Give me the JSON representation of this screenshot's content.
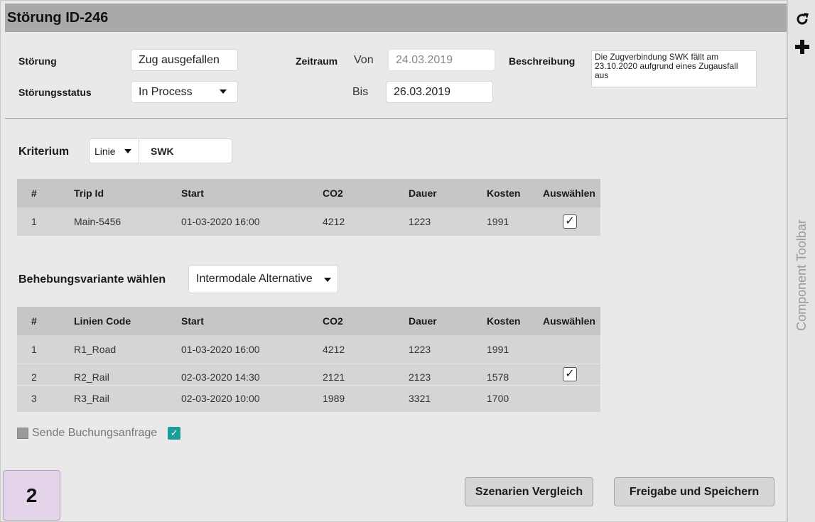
{
  "title": "Störung ID-246",
  "form": {
    "stoerung_label": "Störung",
    "stoerung_value": "Zug ausgefallen",
    "status_label": "Störungsstatus",
    "status_value": "In Process",
    "zeitraum_label": "Zeitraum",
    "von_label": "Von",
    "von_value": "24.03.2019",
    "bis_label": "Bis",
    "bis_value": "26.03.2019",
    "beschreibung_label": "Beschreibung",
    "beschreibung_value": "Die Zugverbindung SWK fällt am 23.10.2020 aufgrund eines Zugausfall aus"
  },
  "kriterium": {
    "label": "Kriterium",
    "type_value": "Linie",
    "filter_value": "SWK"
  },
  "trip_table": {
    "headers": [
      "#",
      "Trip Id",
      "Start",
      "CO2",
      "Dauer",
      "Kosten",
      "Auswählen"
    ],
    "rows": [
      {
        "num": "1",
        "id": "Main-5456",
        "start": "01-03-2020 16:00",
        "co2": "4212",
        "dauer": "1223",
        "kosten": "1991",
        "selected": true
      }
    ]
  },
  "behebung": {
    "label": "Behebungsvariante wählen",
    "value": "Intermodale Alternative"
  },
  "variant_table": {
    "headers": [
      "#",
      "Linien Code",
      "Start",
      "CO2",
      "Dauer",
      "Kosten",
      "Auswählen"
    ],
    "rows": [
      {
        "num": "1",
        "code": "R1_Road",
        "start": "01-03-2020 16:00",
        "co2": "4212",
        "dauer": "1223",
        "kosten": "1991",
        "selected": false
      },
      {
        "num": "2",
        "code": "R2_Rail",
        "start": "02-03-2020 14:30",
        "co2": "2121",
        "dauer": "2123",
        "kosten": "1578",
        "selected": true
      },
      {
        "num": "3",
        "code": "R3_Rail",
        "start": "02-03-2020 10:00",
        "co2": "1989",
        "dauer": "3321",
        "kosten": "1700",
        "selected": false
      }
    ]
  },
  "booking": {
    "label": "Sende Buchungsanfrage",
    "checked": true
  },
  "buttons": {
    "compare": "Szenarien Vergleich",
    "save": "Freigabe und Speichern"
  },
  "page_badge": "2",
  "sidebar": {
    "title": "Component Toolbar",
    "refresh_icon": "refresh-icon",
    "add_icon": "plus-icon"
  },
  "colors": {
    "titlebar": "#a9a9a9",
    "panel": "#e9e9e9",
    "table_header": "#c6c6c6",
    "table_row": "#d5d5d5",
    "teal_check": "#1e9c9a",
    "page_badge": "#e4d4ea"
  }
}
